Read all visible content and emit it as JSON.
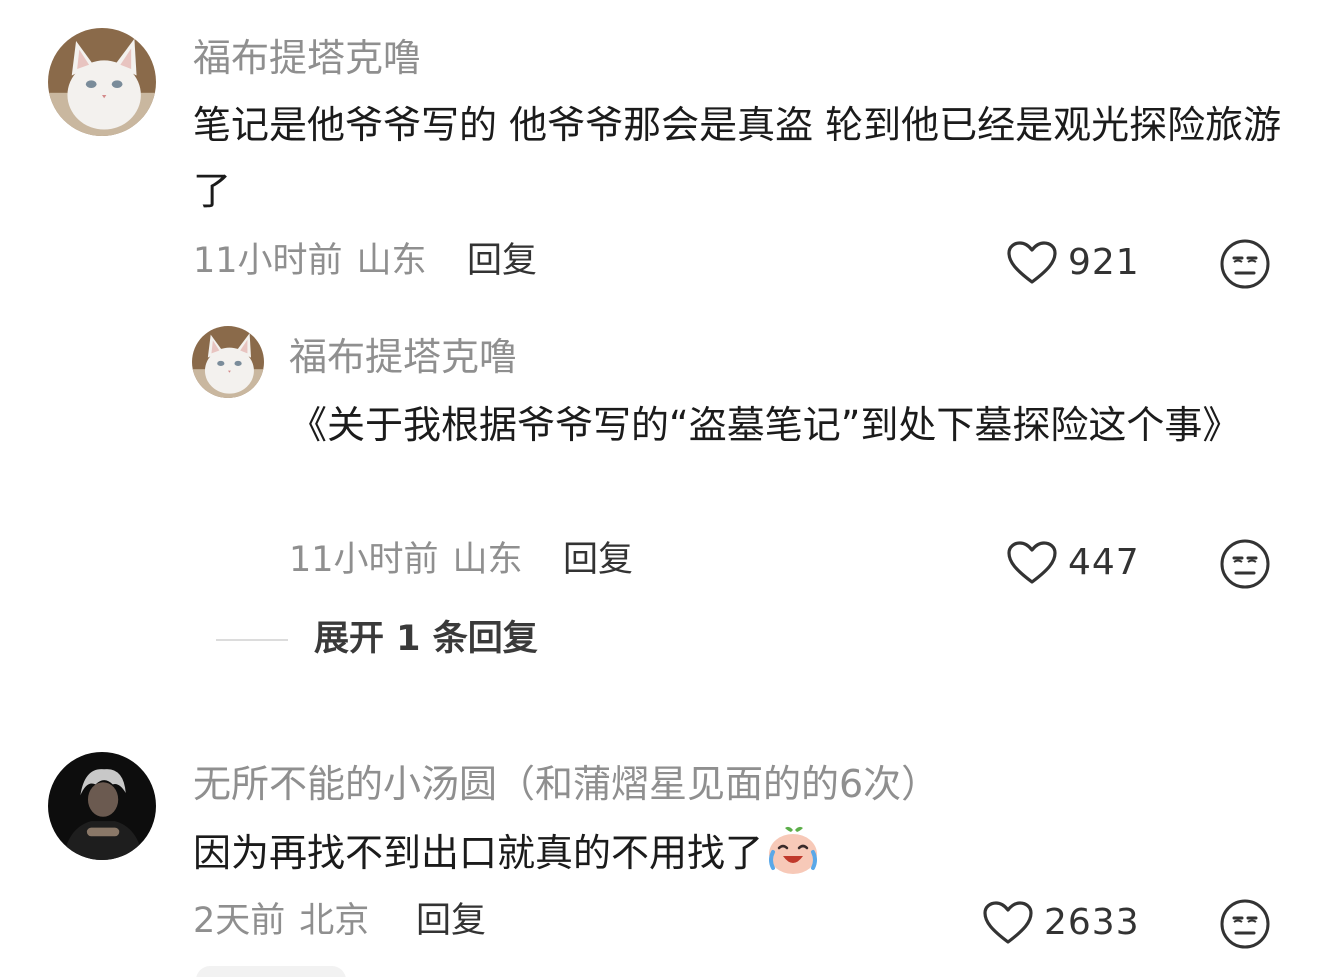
{
  "comments": [
    {
      "user": "福布提塔克噜",
      "text": "笔记是他爷爷写的 他爷爷那会是真盗  轮到他已经是观光探险旅游了",
      "time": "11小时前",
      "location": "山东",
      "reply_label": "回复",
      "likes": "921",
      "reply": {
        "user": "福布提塔克噜",
        "text": "《关于我根据爷爷写的“盗墓笔记”到处下墓探险这个事》",
        "time": "11小时前",
        "location": "山东",
        "reply_label": "回复",
        "likes": "447"
      },
      "expand_label": "展开 1 条回复"
    },
    {
      "user": "无所不能的小汤圆（和蒲熠星见面的的6次）",
      "text": "因为再找不到出口就真的不用找了",
      "time": "2天前",
      "location": "北京",
      "reply_label": "回复",
      "likes": "2633"
    }
  ],
  "icons": {
    "like": "heart-outline-icon",
    "dislike": "unamused-face-icon",
    "emoji": "crying-laughing-peach-emoji"
  },
  "colors": {
    "username": "#8f8f8f",
    "text": "#1b1b1b",
    "meta": "#8f8f8f",
    "icon": "#333333"
  }
}
